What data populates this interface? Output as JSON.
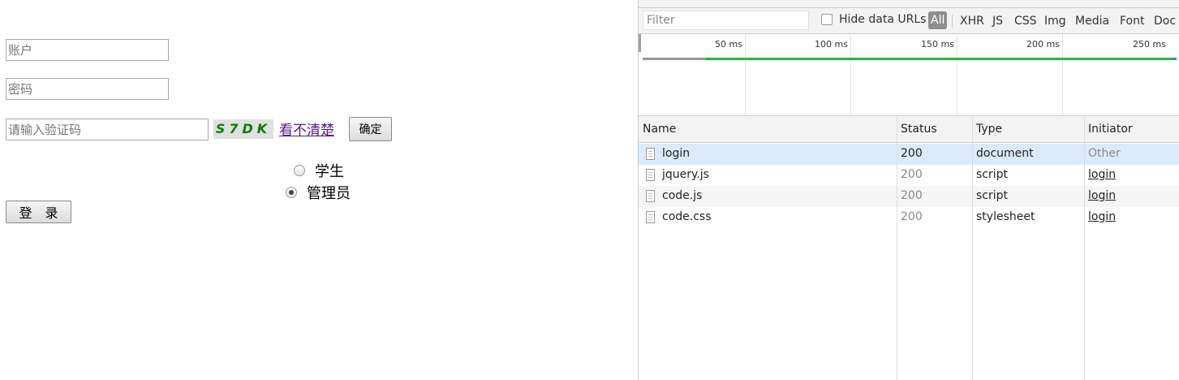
{
  "form": {
    "account_placeholder": "账户",
    "password_placeholder": "密码",
    "captcha_placeholder": "请输入验证码",
    "captcha_code": "S7DK",
    "refresh_link": "看不清楚",
    "confirm_button": "确定",
    "radio_student": "学生",
    "radio_admin": "管理员",
    "selected_role": "管理员",
    "login_button": "登　录"
  },
  "devtools": {
    "filter_placeholder": "Filter",
    "hide_data_urls": "Hide data URLs",
    "types": [
      "All",
      "XHR",
      "JS",
      "CSS",
      "Img",
      "Media",
      "Font",
      "Doc"
    ],
    "active_type": "All",
    "ticks": [
      "50 ms",
      "100 ms",
      "150 ms",
      "200 ms",
      "250 ms"
    ],
    "columns": [
      "Name",
      "Status",
      "Type",
      "Initiator"
    ],
    "rows": [
      {
        "name": "login",
        "status": "200",
        "type": "document",
        "initiator": "Other"
      },
      {
        "name": "jquery.js",
        "status": "200",
        "type": "script",
        "initiator": "login"
      },
      {
        "name": "code.js",
        "status": "200",
        "type": "script",
        "initiator": "login"
      },
      {
        "name": "code.css",
        "status": "200",
        "type": "stylesheet",
        "initiator": "login"
      }
    ]
  },
  "colors": {
    "captcha_text": "#0a7a0a",
    "link_visited": "#551a8b",
    "timeline_green": "#1dbf3a",
    "timeline_blue": "#1e88e5",
    "selected_row": "#dbeafd"
  }
}
